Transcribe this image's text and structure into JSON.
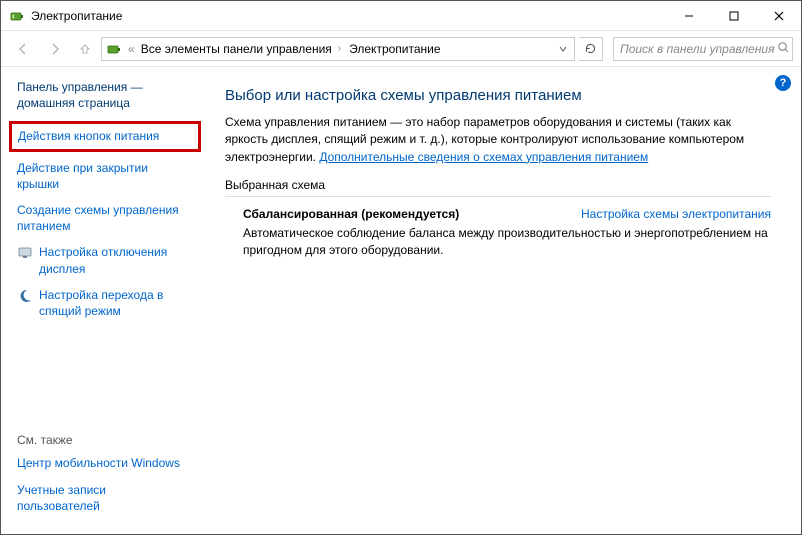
{
  "titlebar": {
    "title": "Электропитание"
  },
  "nav": {
    "breadcrumb1": "Все элементы панели управления",
    "breadcrumb2": "Электропитание",
    "search_placeholder": "Поиск в панели управления"
  },
  "sidebar": {
    "home1": "Панель управления —",
    "home2": "домашняя страница",
    "item_power_buttons": "Действия кнопок питания",
    "item_lid1": "Действие при закрытии",
    "item_lid2": "крышки",
    "item_create1": "Создание схемы управления",
    "item_create2": "питанием",
    "item_display1": "Настройка отключения",
    "item_display2": "дисплея",
    "item_sleep1": "Настройка перехода в",
    "item_sleep2": "спящий режим",
    "see_also": "См. также",
    "mobility": "Центр мобильности Windows",
    "accounts1": "Учетные записи",
    "accounts2": "пользователей"
  },
  "main": {
    "heading": "Выбор или настройка схемы управления питанием",
    "desc1": "Схема управления питанием — это набор параметров оборудования и системы (таких как яркость дисплея, спящий режим и т. д.), которые контролируют использование компьютером электроэнергии. ",
    "desc_link": "Дополнительные сведения о схемах управления питанием",
    "section_label": "Выбранная схема",
    "plan_name": "Сбалансированная (рекомендуется)",
    "plan_settings_link": "Настройка схемы электропитания",
    "plan_desc": "Автоматическое соблюдение баланса между производительностью и энергопотреблением на пригодном для этого оборудовании."
  }
}
